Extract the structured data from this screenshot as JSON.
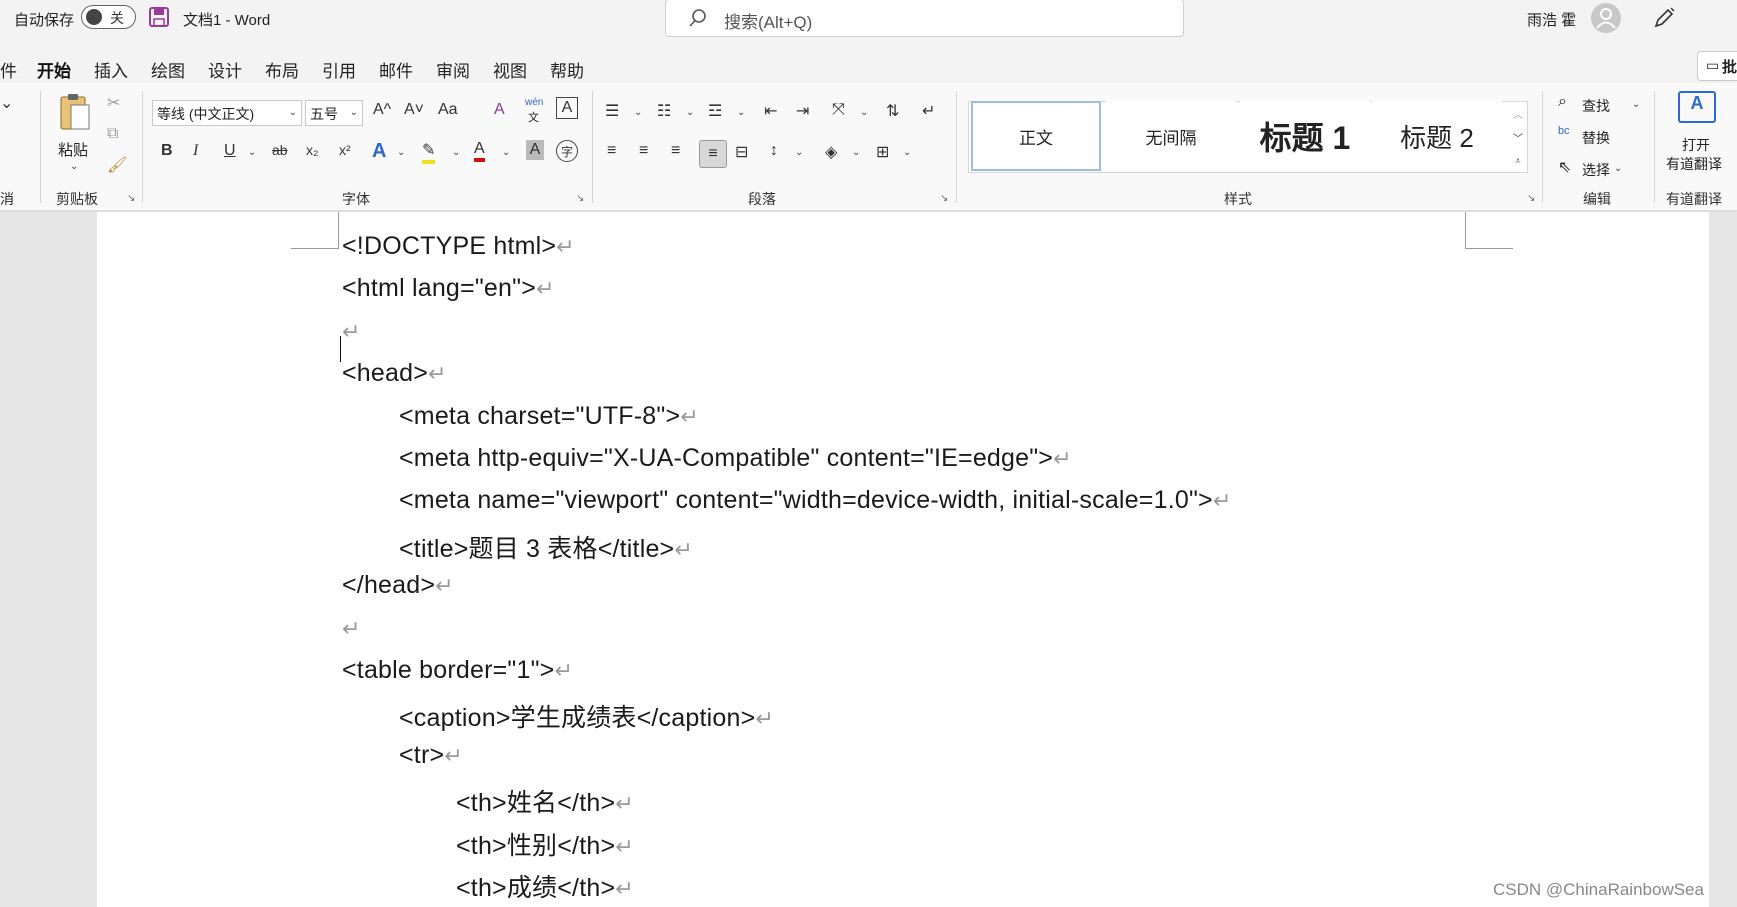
{
  "titlebar": {
    "autosave_label": "自动保存",
    "autosave_state": "关",
    "doc_title": "文档1 - Word",
    "search_placeholder": "搜索(Alt+Q)",
    "user_name": "雨浩 霍"
  },
  "menu": {
    "items": [
      "件",
      "开始",
      "插入",
      "绘图",
      "设计",
      "布局",
      "引用",
      "邮件",
      "审阅",
      "视图",
      "帮助"
    ],
    "comment_btn": "批"
  },
  "ribbon": {
    "undo_label": "消",
    "clipboard": {
      "paste": "粘贴",
      "group": "剪贴板"
    },
    "font": {
      "family": "等线 (中文正文)",
      "size": "五号",
      "grow": "A^",
      "shrink": "A˅",
      "case": "Aa",
      "clear": "A",
      "pinyin": "wén",
      "pinyin_sub": "文",
      "border": "A",
      "bold": "B",
      "italic": "I",
      "underline": "U",
      "strike": "ab",
      "subscript": "x₂",
      "superscript": "x²",
      "effect": "A",
      "highlight": "✎",
      "color": "A",
      "shade": "A",
      "enclose": "字",
      "group": "字体"
    },
    "paragraph": {
      "group": "段落"
    },
    "styles": {
      "items": [
        "正文",
        "无间隔",
        "标题 1",
        "标题 2"
      ],
      "group": "样式"
    },
    "editing": {
      "find": "查找",
      "replace": "替换",
      "select": "选择",
      "group": "编辑"
    },
    "translate": {
      "label1": "打开",
      "label2": "有道翻译",
      "group": "有道翻译"
    }
  },
  "document": {
    "lines": [
      {
        "text": "<!DOCTYPE html>",
        "indent": 0
      },
      {
        "text": "<html lang=\"en\">",
        "indent": 0
      },
      {
        "text": "",
        "indent": 0
      },
      {
        "text": "<head>",
        "indent": 0
      },
      {
        "text": "<meta charset=\"UTF-8\">",
        "indent": 1
      },
      {
        "text": "<meta http-equiv=\"X-UA-Compatible\" content=\"IE=edge\">",
        "indent": 1
      },
      {
        "text": "<meta name=\"viewport\" content=\"width=device-width, initial-scale=1.0\">",
        "indent": 1
      },
      {
        "text": "<title>题目 3 表格</title>",
        "indent": 1
      },
      {
        "text": "</head>",
        "indent": 0
      },
      {
        "text": "",
        "indent": 0
      },
      {
        "text": "<table border=\"1\">",
        "indent": 0
      },
      {
        "text": "<caption>学生成绩表</caption>",
        "indent": 1
      },
      {
        "text": "<tr>",
        "indent": 1
      },
      {
        "text": "<th>姓名</th>",
        "indent": 2
      },
      {
        "text": "<th>性别</th>",
        "indent": 2
      },
      {
        "text": "<th>成绩</th>",
        "indent": 2
      }
    ],
    "return_mark": "↵"
  },
  "watermark": "CSDN @ChinaRainbowSea"
}
